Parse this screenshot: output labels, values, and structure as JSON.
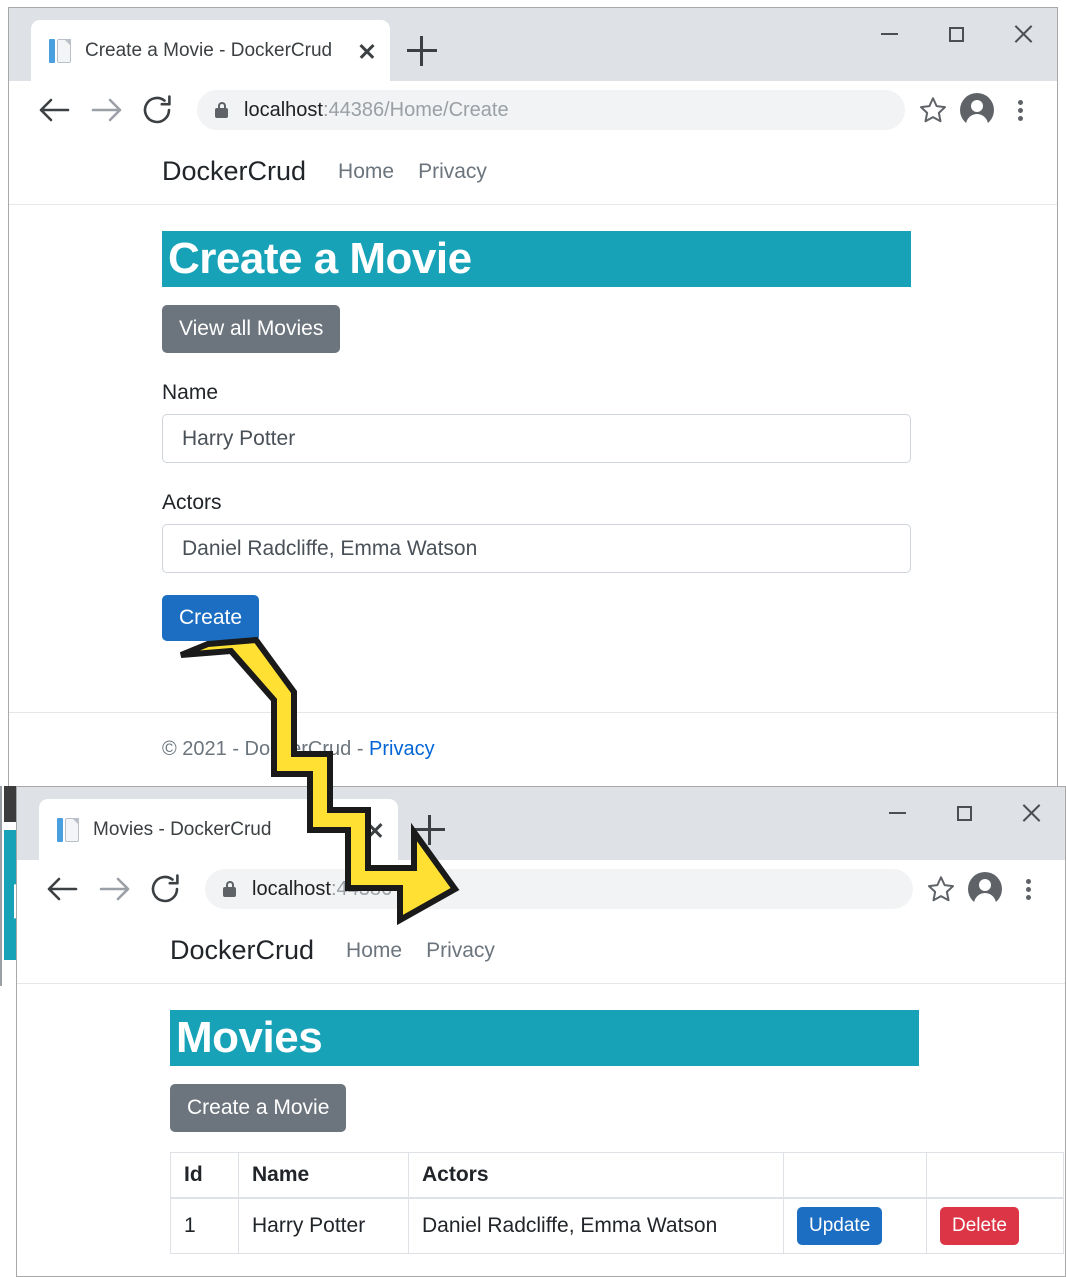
{
  "colors": {
    "teal_header": "#17a2b8",
    "primary_blue": "#1b6ec2",
    "danger_red": "#dc3545",
    "secondary_gray": "#6c757d",
    "link_blue": "#0366d6",
    "arrow_yellow": "#FFE033"
  },
  "window_create": {
    "tab": {
      "title": "Create a Movie - DockerCrud",
      "favicon": "page-icon",
      "close_icon": "close-icon",
      "new_tab_icon": "plus-icon"
    },
    "controls": {
      "minimize": "minimize-icon",
      "maximize": "maximize-icon",
      "close": "close-icon"
    },
    "toolbar": {
      "back_icon": "back-arrow-icon",
      "forward_icon": "forward-arrow-icon",
      "reload_icon": "reload-icon",
      "lock_icon": "lock-icon",
      "url_host": "localhost",
      "url_rest": ":44386/Home/Create",
      "bookmark_icon": "star-icon",
      "profile_icon": "avatar-icon",
      "menu_icon": "kebab-menu-icon"
    },
    "sitenav": {
      "brand": "DockerCrud",
      "links": [
        "Home",
        "Privacy"
      ]
    },
    "heading": "Create a Movie",
    "view_all_button": "View all Movies",
    "form": {
      "name_label": "Name",
      "name_value": "Harry Potter",
      "actors_label": "Actors",
      "actors_value": "Daniel Radcliffe, Emma Watson",
      "submit_button": "Create"
    },
    "footer": {
      "copyright": "© 2021 - DockerCrud - ",
      "privacy_link": "Privacy"
    }
  },
  "window_movies": {
    "tab": {
      "title": "Movies - DockerCrud",
      "favicon": "page-icon",
      "close_icon": "close-icon",
      "new_tab_icon": "plus-icon"
    },
    "controls": {
      "minimize": "minimize-icon",
      "maximize": "maximize-icon",
      "close": "close-icon"
    },
    "toolbar": {
      "back_icon": "back-arrow-icon",
      "forward_icon": "forward-arrow-icon",
      "reload_icon": "reload-icon",
      "lock_icon": "lock-icon",
      "url_host": "localhost",
      "url_rest": ":44386",
      "bookmark_icon": "star-icon",
      "profile_icon": "avatar-icon",
      "menu_icon": "kebab-menu-icon"
    },
    "sitenav": {
      "brand": "DockerCrud",
      "links": [
        "Home",
        "Privacy"
      ]
    },
    "heading": "Movies",
    "create_button": "Create a Movie",
    "table": {
      "headers": [
        "Id",
        "Name",
        "Actors",
        "",
        ""
      ],
      "rows": [
        {
          "id": "1",
          "name": "Harry Potter",
          "actors": "Daniel Radcliffe, Emma Watson",
          "update_button": "Update",
          "delete_button": "Delete"
        }
      ]
    }
  },
  "annotation": {
    "arrow": "zigzag-arrow-pointing-down-right"
  }
}
